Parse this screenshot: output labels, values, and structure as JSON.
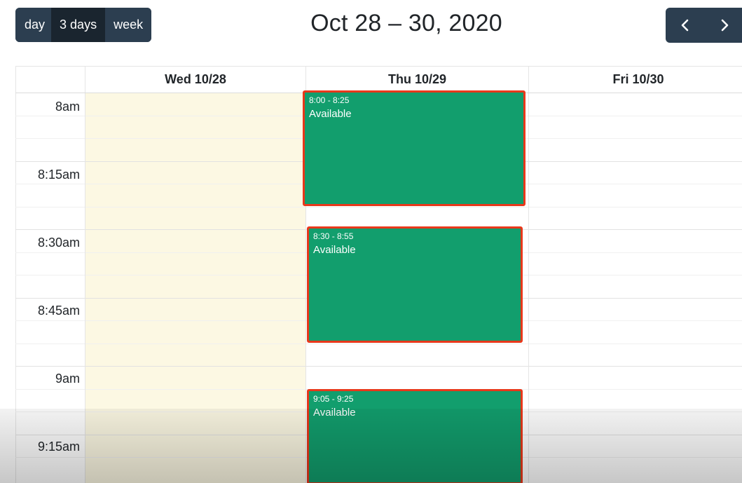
{
  "toolbar": {
    "views": [
      {
        "label": "day",
        "active": false
      },
      {
        "label": "3 days",
        "active": true
      },
      {
        "label": "week",
        "active": false
      }
    ],
    "title": "Oct 28 – 30, 2020",
    "prev_icon": "chevron-left-icon",
    "next_icon": "chevron-right-icon"
  },
  "calendar": {
    "days": [
      "Wed 10/28",
      "Thu 10/29",
      "Fri 10/30"
    ],
    "today": "Wed 10/28",
    "time_labels": [
      "8am",
      "8:15am",
      "8:30am",
      "8:45am",
      "9am",
      "9:15am"
    ],
    "events": [
      {
        "day": "Thu 10/29",
        "time": "8:00 - 8:25",
        "title": "Available"
      },
      {
        "day": "Thu 10/29",
        "time": "8:30 - 8:55",
        "title": "Available"
      },
      {
        "day": "Thu 10/29",
        "time": "9:05 - 9:25",
        "title": "Available"
      }
    ]
  },
  "colors": {
    "toolbar": "#2c3e50",
    "event_bg": "#129e6d",
    "event_highlight": "#e8381b",
    "today_bg": "#fcf8e3"
  }
}
